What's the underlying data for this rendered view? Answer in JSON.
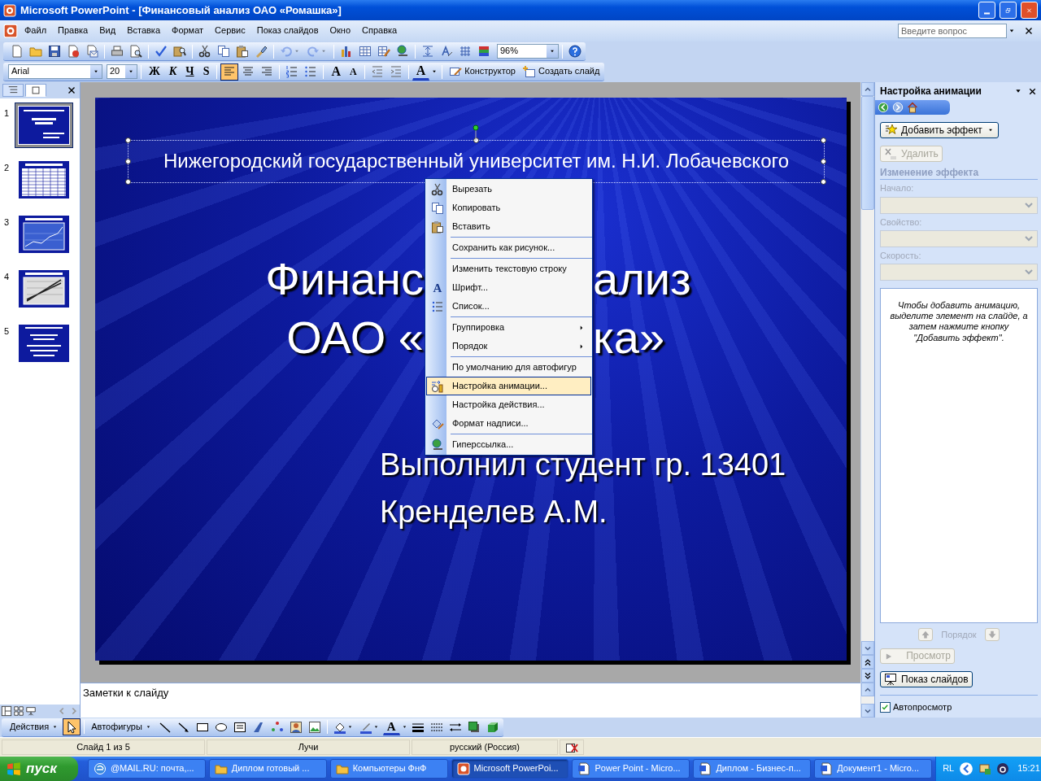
{
  "window": {
    "title": "Microsoft PowerPoint - [Финансовый анализ ОАО «Ромашка»]"
  },
  "menu_bar": {
    "items": [
      "Файл",
      "Правка",
      "Вид",
      "Вставка",
      "Формат",
      "Сервис",
      "Показ слайдов",
      "Окно",
      "Справка"
    ],
    "help_search": {
      "placeholder": "Введите вопрос"
    }
  },
  "standard_toolbar": {
    "button_groups": [
      [
        {
          "kind": "new",
          "disabled": false
        },
        {
          "kind": "open",
          "disabled": false
        },
        {
          "kind": "save",
          "disabled": false
        },
        {
          "kind": "permission",
          "disabled": false
        },
        {
          "kind": "email",
          "disabled": false
        }
      ],
      [
        {
          "kind": "print",
          "disabled": false
        },
        {
          "kind": "preview",
          "disabled": false
        }
      ],
      [
        {
          "kind": "spelling",
          "disabled": false
        },
        {
          "kind": "research",
          "disabled": false
        }
      ],
      [
        {
          "kind": "cut",
          "disabled": false
        },
        {
          "kind": "copy",
          "disabled": false
        },
        {
          "kind": "paste",
          "disabled": false
        },
        {
          "kind": "painter",
          "disabled": false
        }
      ],
      [
        {
          "kind": "undo",
          "disabled": true
        },
        {
          "kind": "redo",
          "disabled": true
        }
      ],
      [
        {
          "kind": "chart",
          "disabled": false
        },
        {
          "kind": "table",
          "disabled": false
        },
        {
          "kind": "tables_borders",
          "disabled": false
        },
        {
          "kind": "hyperlink",
          "disabled": false
        }
      ],
      [
        {
          "kind": "expand",
          "disabled": false
        },
        {
          "kind": "formatting",
          "disabled": false
        },
        {
          "kind": "grid",
          "disabled": false
        },
        {
          "kind": "color",
          "disabled": false
        }
      ]
    ],
    "zoom": "96%"
  },
  "formatting_toolbar": {
    "font": "Arial",
    "size": "20",
    "style_buttons": [
      "Ж",
      "К",
      "Ч",
      "S"
    ],
    "align_buttons": [
      {
        "kind": "left",
        "selected": true
      },
      {
        "kind": "center",
        "selected": false
      },
      {
        "kind": "right",
        "selected": false
      }
    ],
    "size_buttons": [
      "A",
      "A"
    ],
    "font_color": "A",
    "design_button": "Конструктор",
    "new_slide_button": "Создать слайд"
  },
  "slides_pane": {
    "tabs": [
      {
        "kind": "outline",
        "selected": false
      },
      {
        "kind": "slides",
        "selected": true
      }
    ],
    "thumbnails": [
      {
        "number": "1",
        "kind": "title",
        "selected": true
      },
      {
        "number": "2",
        "kind": "table",
        "selected": false
      },
      {
        "number": "3",
        "kind": "chart",
        "selected": false
      },
      {
        "number": "4",
        "kind": "plot",
        "selected": false
      },
      {
        "number": "5",
        "kind": "text",
        "selected": false
      }
    ]
  },
  "slide": {
    "header": "Нижегородский государственный университет им. Н.И. Лобачевского",
    "title_lines": [
      {
        "left": "Финанс",
        "right": "ализ"
      },
      {
        "left": "ОАО «",
        "right": "ка»"
      }
    ],
    "subtitle_lines": [
      "Выполнил студент гр. 13401",
      "Кренделев А.М."
    ]
  },
  "context_menu": {
    "groups": [
      [
        {
          "label": "Вырезать",
          "kind": "cut",
          "submenu": false,
          "selected": false
        },
        {
          "label": "Копировать",
          "kind": "copy",
          "submenu": false,
          "selected": false
        },
        {
          "label": "Вставить",
          "kind": "paste",
          "submenu": false,
          "selected": false
        }
      ],
      [
        {
          "label": "Сохранить как рисунок...",
          "kind": "plain",
          "submenu": false,
          "selected": false
        }
      ],
      [
        {
          "label": "Изменить текстовую строку",
          "kind": "plain",
          "submenu": false,
          "selected": false
        },
        {
          "label": "Шрифт...",
          "kind": "font",
          "glyph": "A",
          "submenu": false,
          "selected": false
        },
        {
          "label": "Список...",
          "kind": "list",
          "submenu": false,
          "selected": false
        }
      ],
      [
        {
          "label": "Группировка",
          "kind": "plain",
          "submenu": true,
          "selected": false
        },
        {
          "label": "Порядок",
          "kind": "plain",
          "submenu": true,
          "selected": false
        }
      ],
      [
        {
          "label": "По умолчанию для автофигур",
          "kind": "plain",
          "submenu": false,
          "selected": false
        },
        {
          "label": "Настройка анимации...",
          "kind": "animation",
          "submenu": false,
          "selected": true
        },
        {
          "label": "Настройка действия...",
          "kind": "plain",
          "submenu": false,
          "selected": false
        },
        {
          "label": "Формат надписи...",
          "kind": "format",
          "submenu": false,
          "selected": false
        }
      ],
      [
        {
          "label": "Гиперссылка...",
          "kind": "link",
          "submenu": false,
          "selected": false
        }
      ]
    ]
  },
  "notes": {
    "placeholder": "Заметки к слайду"
  },
  "task_pane": {
    "title": "Настройка анимации",
    "add_effect": "Добавить эффект",
    "remove": {
      "label": "Удалить",
      "disabled": true
    },
    "section": "Изменение эффекта",
    "fields": [
      {
        "label": "Начало:",
        "disabled": true
      },
      {
        "label": "Свойство:",
        "disabled": true
      },
      {
        "label": "Скорость:",
        "disabled": true
      }
    ],
    "hint": "Чтобы добавить анимацию, выделите элемент на слайде, а затем нажмите кнопку \"Добавить эффект\".",
    "reorder": {
      "label": "Порядок",
      "disabled": true
    },
    "preview": {
      "label": "Просмотр",
      "disabled": true
    },
    "slideshow": "Показ слайдов",
    "autopreview": {
      "label": "Автопросмотр",
      "checked": true
    }
  },
  "drawing_toolbar": {
    "actions": "Действия",
    "pointer_selected": true,
    "autoshapes": "Автофигуры",
    "font_color": "A"
  },
  "status_bar": {
    "fields": [
      "Слайд 1 из 5",
      "Лучи",
      "русский (Россия)"
    ]
  },
  "taskbar": {
    "start": "пуск",
    "tasks": [
      {
        "label": "@MAIL.RU: почта,...",
        "kind": "browser",
        "selected": false
      },
      {
        "label": "Диплом готовый ...",
        "kind": "folder",
        "selected": false
      },
      {
        "label": "Компьютеры ФнФ",
        "kind": "folder",
        "selected": false
      },
      {
        "label": "Microsoft PowerPoi...",
        "kind": "presentation",
        "selected": true
      },
      {
        "label": "Power Point - Micro...",
        "kind": "document",
        "selected": false
      },
      {
        "label": "Диплом - Бизнес-п...",
        "kind": "document",
        "selected": false
      },
      {
        "label": "Документ1 - Micro...",
        "kind": "document",
        "selected": false
      }
    ],
    "language": "RL",
    "clock": "15:21"
  }
}
